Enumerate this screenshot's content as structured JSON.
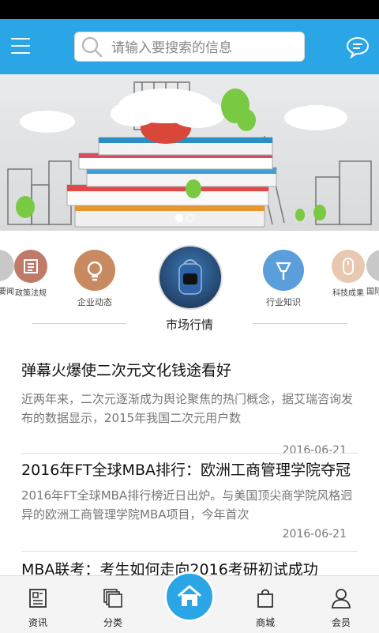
{
  "search": {
    "placeholder": "请输入要搜索的信息"
  },
  "categories": [
    {
      "label": "要闻",
      "color": "#c8c8c8",
      "icon": "news-icon"
    },
    {
      "label": "政策法规",
      "color": "#c07a6a",
      "icon": "document-icon"
    },
    {
      "label": "企业动态",
      "color": "#c88a60",
      "icon": "lightbulb-icon"
    },
    {
      "label": "市场行情",
      "color": "#2a4a70",
      "icon": "backpack-photo"
    },
    {
      "label": "行业知识",
      "color": "#5a9fdc",
      "icon": "microphone-icon"
    },
    {
      "label": "科技成果",
      "color": "#e8c8b0",
      "icon": "mouse-icon"
    },
    {
      "label": "国际",
      "color": "#c8c8c8",
      "icon": "link-icon"
    }
  ],
  "section": {
    "title": "市场行情"
  },
  "news": [
    {
      "title": "弹幕火爆使二次元文化钱途看好",
      "desc": "近两年来，二次元逐渐成为舆论聚焦的热门概念，据艾瑞咨询发布的数据显示，2015年我国二次元用户数",
      "date": "2016-06-21"
    },
    {
      "title": "2016年FT全球MBA排行：欧洲工商管理学院夺冠",
      "desc": "2016年FT全球MBA排行榜近日出炉。与美国顶尖商学院风格迥异的欧洲工商管理学院MBA项目，今年首次",
      "date": "2016-06-21"
    },
    {
      "title": "MBA联考：考生如何走向2016考研初试成功",
      "desc": "",
      "date": ""
    }
  ],
  "tabbar": [
    {
      "label": "资讯",
      "icon": "newspaper-icon"
    },
    {
      "label": "分类",
      "icon": "layers-icon"
    },
    {
      "label": "",
      "icon": "home-icon"
    },
    {
      "label": "商城",
      "icon": "shopping-bag-icon"
    },
    {
      "label": "会员",
      "icon": "user-icon"
    }
  ],
  "colors": {
    "primary": "#2aa5e6"
  }
}
